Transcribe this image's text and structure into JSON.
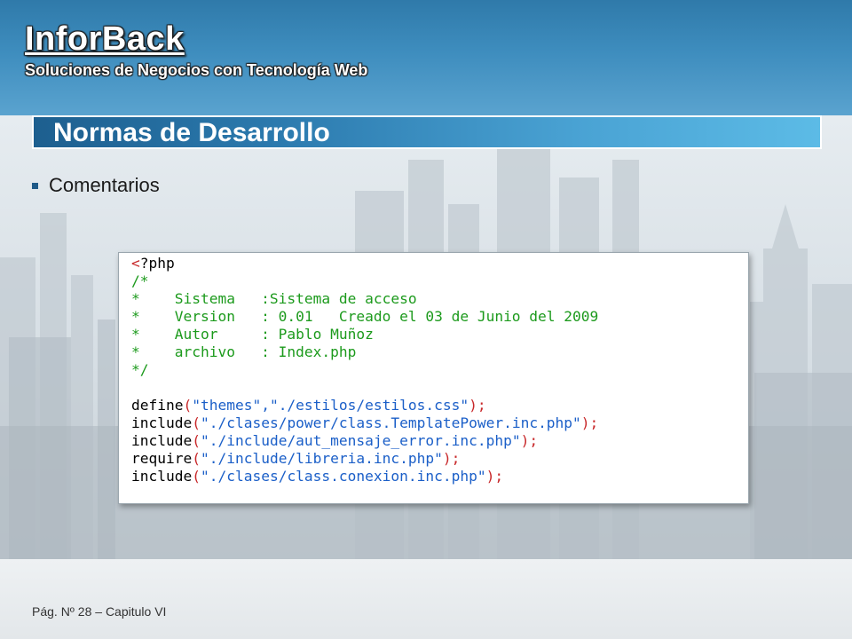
{
  "brand": {
    "name": "InforBack",
    "tagline": "Soluciones de Negocios con Tecnología Web"
  },
  "slide": {
    "title": "Normas de Desarrollo",
    "bullet": "Comentarios"
  },
  "code": {
    "open_tag": "<?php",
    "comment_start": "/*",
    "comment_lines": [
      "*    Sistema   :Sistema de acceso",
      "*    Version   : 0.01   Creado el 03 de Junio del 2009",
      "*    Autor     : Pablo Muñoz",
      "*    archivo   : Index.php"
    ],
    "comment_end": "*/",
    "statements": [
      {
        "fn": "define",
        "args": "\"themes\",\"./estilos/estilos.css\"",
        "end": ";"
      },
      {
        "fn": "include",
        "args": "\"./clases/power/class.TemplatePower.inc.php\"",
        "end": ";"
      },
      {
        "fn": "include",
        "args": "\"./include/aut_mensaje_error.inc.php\"",
        "end": ";"
      },
      {
        "fn": "require",
        "args": "\"./include/libreria.inc.php\"",
        "end": ";"
      },
      {
        "fn": "include",
        "args": "\"./clases/class.conexion.inc.php\"",
        "end": ";"
      }
    ]
  },
  "footer": {
    "text": "Pág. Nº 28 – Capitulo VI"
  },
  "colors": {
    "accent": "#2b79ad",
    "code_comment": "#1c9a1c",
    "code_string": "#1b5fc8",
    "code_paren": "#c8282a"
  }
}
